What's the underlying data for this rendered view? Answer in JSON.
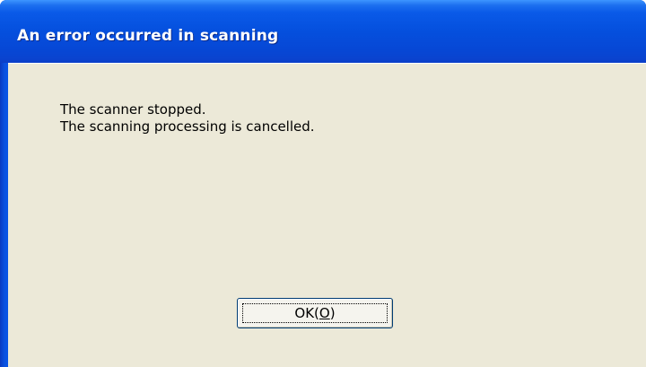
{
  "window": {
    "title": "An error occurred in scanning"
  },
  "message": {
    "line1": "The scanner stopped.",
    "line2": "The scanning processing is cancelled."
  },
  "buttons": {
    "ok_prefix": "OK(",
    "ok_mnemonic": "O",
    "ok_suffix": ")"
  },
  "colors": {
    "titlebar": "#0550de",
    "client_background": "#ece9d8",
    "button_border": "#003c74"
  }
}
